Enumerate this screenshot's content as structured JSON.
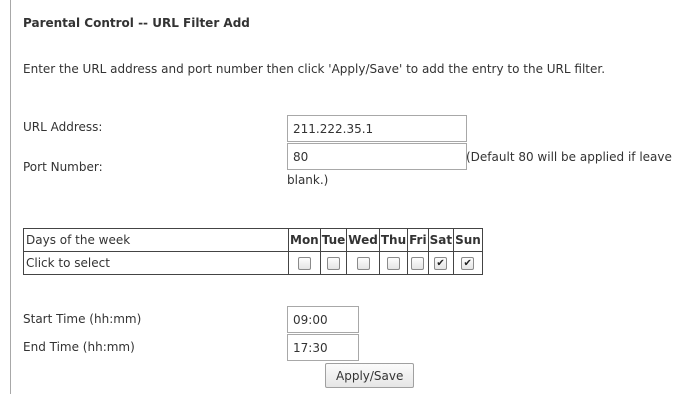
{
  "page": {
    "title": "Parental Control -- URL Filter Add",
    "instructions": "Enter the URL address and port number then click 'Apply/Save' to add the entry to the URL filter."
  },
  "form": {
    "url_label": "URL Address:",
    "url_value": "211.222.35.1",
    "port_label": "Port Number:",
    "port_value": "80",
    "port_hint_line1": "(Default 80 will be applied if leave",
    "port_hint_line2": "blank.)"
  },
  "schedule": {
    "header_label": "Days of the week",
    "select_label": "Click to select",
    "days": [
      {
        "label": "Mon",
        "checked": false
      },
      {
        "label": "Tue",
        "checked": false
      },
      {
        "label": "Wed",
        "checked": false
      },
      {
        "label": "Thu",
        "checked": false
      },
      {
        "label": "Fri",
        "checked": false
      },
      {
        "label": "Sat",
        "checked": true
      },
      {
        "label": "Sun",
        "checked": true
      }
    ]
  },
  "time": {
    "start_label": "Start Time (hh:mm)",
    "start_value": "09:00",
    "end_label": "End Time (hh:mm)",
    "end_value": "17:30"
  },
  "actions": {
    "apply_label": "Apply/Save"
  }
}
